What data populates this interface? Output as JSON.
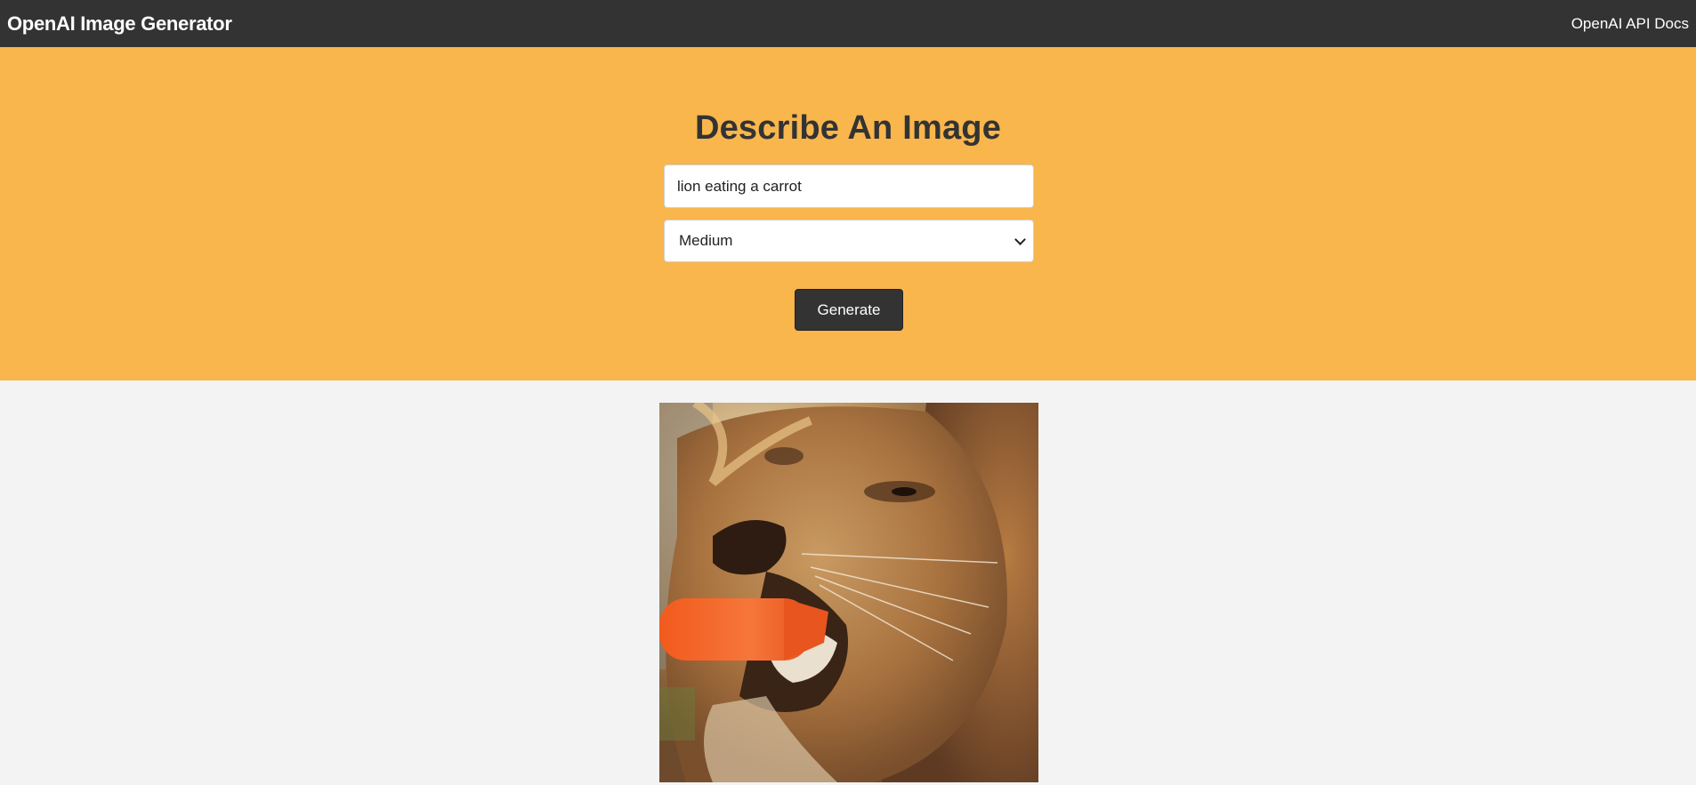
{
  "navbar": {
    "brand": "OpenAI Image Generator",
    "docs_link": "OpenAI API Docs"
  },
  "hero": {
    "title": "Describe An Image",
    "prompt_value": "lion eating a carrot",
    "size_selected": "Medium",
    "generate_label": "Generate"
  },
  "result": {
    "image_subject": "lion eating a carrot"
  },
  "colors": {
    "navbar_bg": "#333333",
    "hero_bg": "#f8b64c",
    "page_bg": "#f3f3f3",
    "button_bg": "#333333"
  }
}
